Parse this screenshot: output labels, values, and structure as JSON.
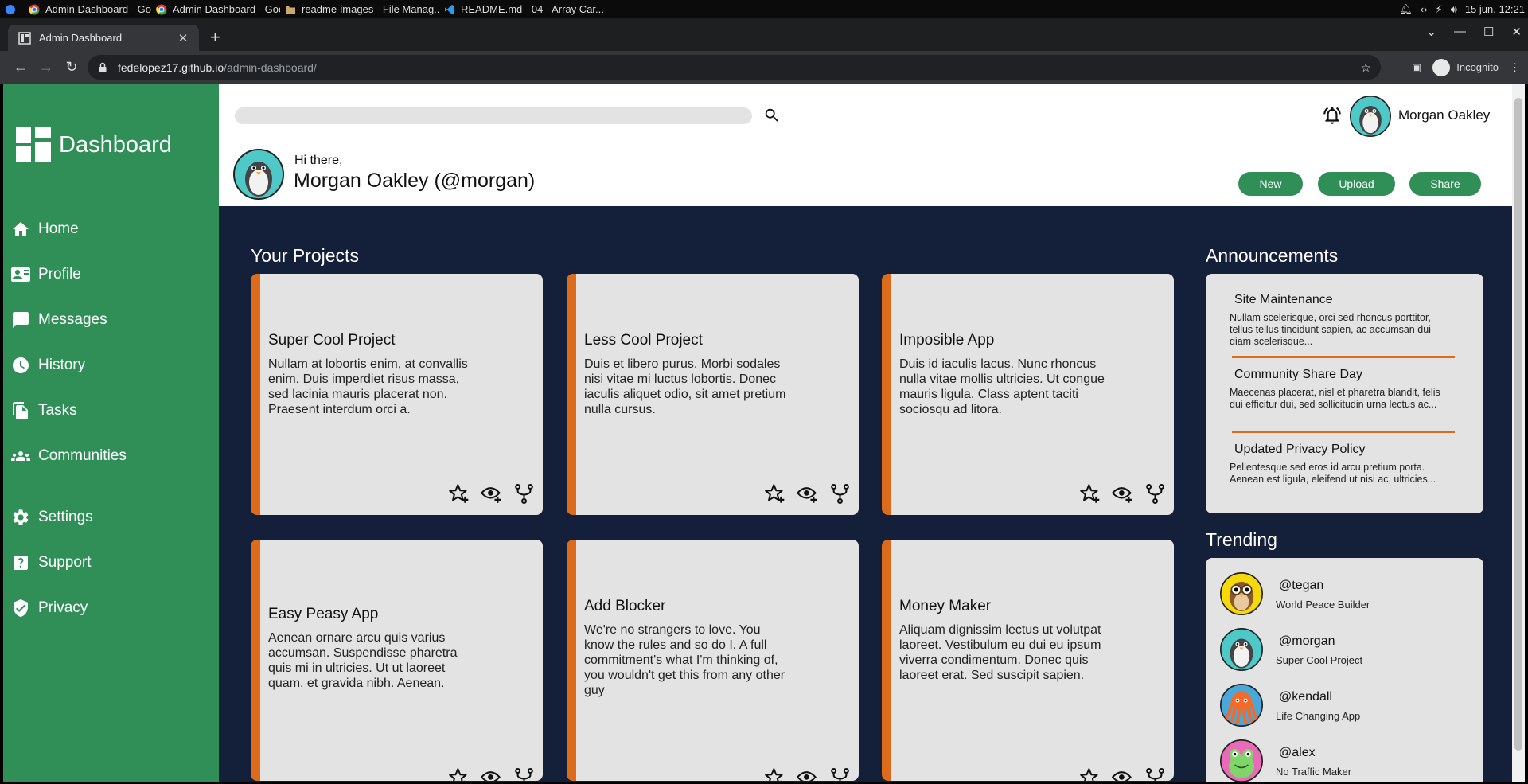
{
  "os": {
    "tasks": [
      {
        "label": "Admin Dashboard - Google ..."
      },
      {
        "label": "Admin Dashboard - Google ..."
      },
      {
        "label": "readme-images - File Manag..."
      },
      {
        "label": "README.md - 04 - Array Car..."
      }
    ],
    "clock": "15 jun, 12:21"
  },
  "browser": {
    "tab_title": "Admin Dashboard",
    "url_host": "fedelopez17.github.io",
    "url_path": "/admin-dashboard/",
    "profile_label": "Incognito"
  },
  "sidebar": {
    "brand": "Dashboard",
    "items": [
      {
        "label": "Home",
        "icon": "home-icon"
      },
      {
        "label": "Profile",
        "icon": "profile-card-icon"
      },
      {
        "label": "Messages",
        "icon": "message-icon"
      },
      {
        "label": "History",
        "icon": "clock-icon"
      },
      {
        "label": "Tasks",
        "icon": "tasks-icon"
      },
      {
        "label": "Communities",
        "icon": "group-icon"
      },
      {
        "label": "Settings",
        "icon": "gear-icon"
      },
      {
        "label": "Support",
        "icon": "help-icon"
      },
      {
        "label": "Privacy",
        "icon": "shield-check-icon"
      }
    ]
  },
  "header": {
    "search_placeholder": "",
    "user_name": "Morgan Oakley",
    "greeting_small": "Hi there,",
    "greeting_big": "Morgan Oakley (@morgan)",
    "buttons": {
      "new": "New",
      "upload": "Upload",
      "share": "Share"
    }
  },
  "projects": {
    "title": "Your Projects",
    "cards": [
      {
        "title": "Super Cool Project",
        "text": "Nullam at lobortis enim, at convallis enim. Duis imperdiet risus massa, sed lacinia mauris placerat non. Praesent interdum orci a."
      },
      {
        "title": "Less Cool Project",
        "text": "Duis et libero purus. Morbi sodales nisi vitae mi luctus lobortis. Donec iaculis aliquet odio, sit amet pretium nulla cursus."
      },
      {
        "title": "Imposible App",
        "text": "Duis id iaculis lacus. Nunc rhoncus nulla vitae mollis ultricies. Ut congue mauris ligula. Class aptent taciti sociosqu ad litora."
      },
      {
        "title": "Easy Peasy App",
        "text": "Aenean ornare arcu quis varius accumsan. Suspendisse pharetra quis mi in ultricies. Ut ut laoreet quam, et gravida nibh. Aenean."
      },
      {
        "title": "Add Blocker",
        "text": "We're no strangers to love. You know the rules and so do I. A full commitment's what I'm thinking of, you wouldn't get this from any other guy"
      },
      {
        "title": "Money Maker",
        "text": "Aliquam dignissim lectus ut volutpat laoreet. Vestibulum eu dui eu ipsum viverra condimentum. Donec quis laoreet erat. Sed suscipit sapien."
      }
    ]
  },
  "announcements": {
    "title": "Announcements",
    "items": [
      {
        "title": "Site Maintenance",
        "text": "Nullam scelerisque, orci sed rhoncus porttitor, tellus tellus tincidunt sapien, ac accumsan dui diam scelerisque..."
      },
      {
        "title": "Community Share Day",
        "text": "Maecenas placerat, nisl et pharetra blandit, felis dui efficitur dui, sed sollicitudin urna lectus ac..."
      },
      {
        "title": "Updated Privacy Policy",
        "text": "Pellentesque sed eros id arcu pretium porta. Aenean est ligula, eleifend ut nisi ac, ultricies..."
      }
    ]
  },
  "trending": {
    "title": "Trending",
    "items": [
      {
        "handle": "@tegan",
        "sub": "World Peace Builder",
        "avatar": "owl-avatar"
      },
      {
        "handle": "@morgan",
        "sub": "Super Cool Project",
        "avatar": "penguin-avatar"
      },
      {
        "handle": "@kendall",
        "sub": "Life Changing App",
        "avatar": "octopus-avatar"
      },
      {
        "handle": "@alex",
        "sub": "No Traffic Maker",
        "avatar": "frog-avatar"
      }
    ]
  },
  "colors": {
    "accent_green": "#2f8f57",
    "accent_orange": "#dc6b1c",
    "main_bg": "#14203a",
    "card_bg": "#e3e3e3"
  }
}
